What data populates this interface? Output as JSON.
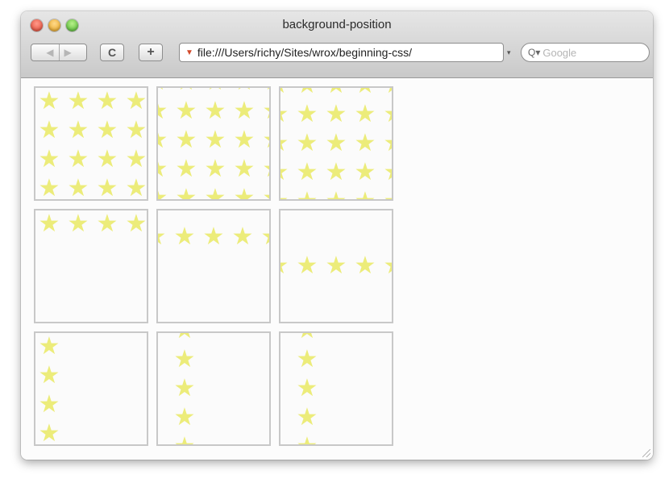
{
  "window": {
    "title": "background-position",
    "colors": {
      "star": "#ecec7a",
      "box_border": "#c8c8c8",
      "close": "#e0412e",
      "minimize": "#e6a21a",
      "zoom": "#49b52c"
    }
  },
  "toolbar": {
    "back_glyph": "◀",
    "forward_glyph": "▶",
    "reload_glyph": "C",
    "add_glyph": "+",
    "address_url": "file:///Users/richy/Sites/wrox/beginning-css/",
    "address_dropdown_glyph": "▾",
    "search_icon_glyph": "Q▾",
    "search_placeholder": "Google"
  },
  "boxes": [
    {
      "id": "repeat-both-top-left",
      "pattern": "repeat"
    },
    {
      "id": "repeat-both-offset",
      "pattern": "repeat-offset"
    },
    {
      "id": "repeat-both-offset-2",
      "pattern": "repeat-offset2"
    },
    {
      "id": "repeat-x-top",
      "pattern": "repeat-x-top"
    },
    {
      "id": "repeat-x-top-offset",
      "pattern": "repeat-x-top-offset"
    },
    {
      "id": "repeat-x-center",
      "pattern": "repeat-x-center"
    },
    {
      "id": "repeat-y-left",
      "pattern": "repeat-y-left"
    },
    {
      "id": "repeat-y-offset",
      "pattern": "repeat-y-offset"
    },
    {
      "id": "repeat-y-offset-2",
      "pattern": "repeat-y-offset2"
    }
  ],
  "icons": {
    "star": "★"
  }
}
